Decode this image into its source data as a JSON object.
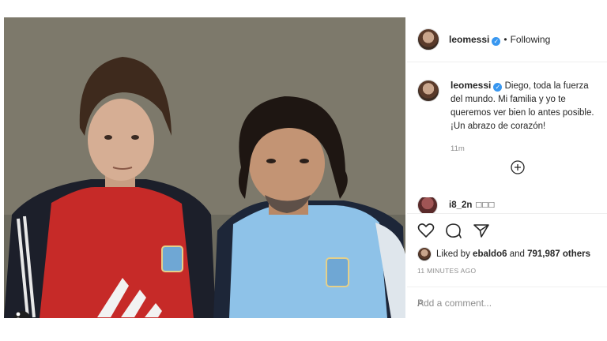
{
  "post": {
    "username": "leomessi",
    "verified_mark": "✓",
    "separator": "•",
    "follow_status": "Following",
    "caption": "Diego, toda la fuerza del mundo. Mi familia y yo te queremos ver bien lo antes posible. ¡Un abrazo de corazón!",
    "caption_time": "11m",
    "comment": {
      "username": "i8_2n",
      "text": "□□□"
    },
    "likes": {
      "prefix": "Liked by ",
      "user": "ebaldo6",
      "joiner": " and ",
      "count": "791,987 others"
    },
    "posted_ago": "11 MINUTES AGO",
    "add_comment_placeholder": "Add a comment...",
    "post_label": "P"
  },
  "icons": [
    "heart-icon",
    "comment-icon",
    "share-icon",
    "add-circle-icon",
    "user-tag-icon"
  ],
  "colors": {
    "verified": "#3897f0",
    "muted": "#8e8e8e",
    "border": "#efefef"
  }
}
